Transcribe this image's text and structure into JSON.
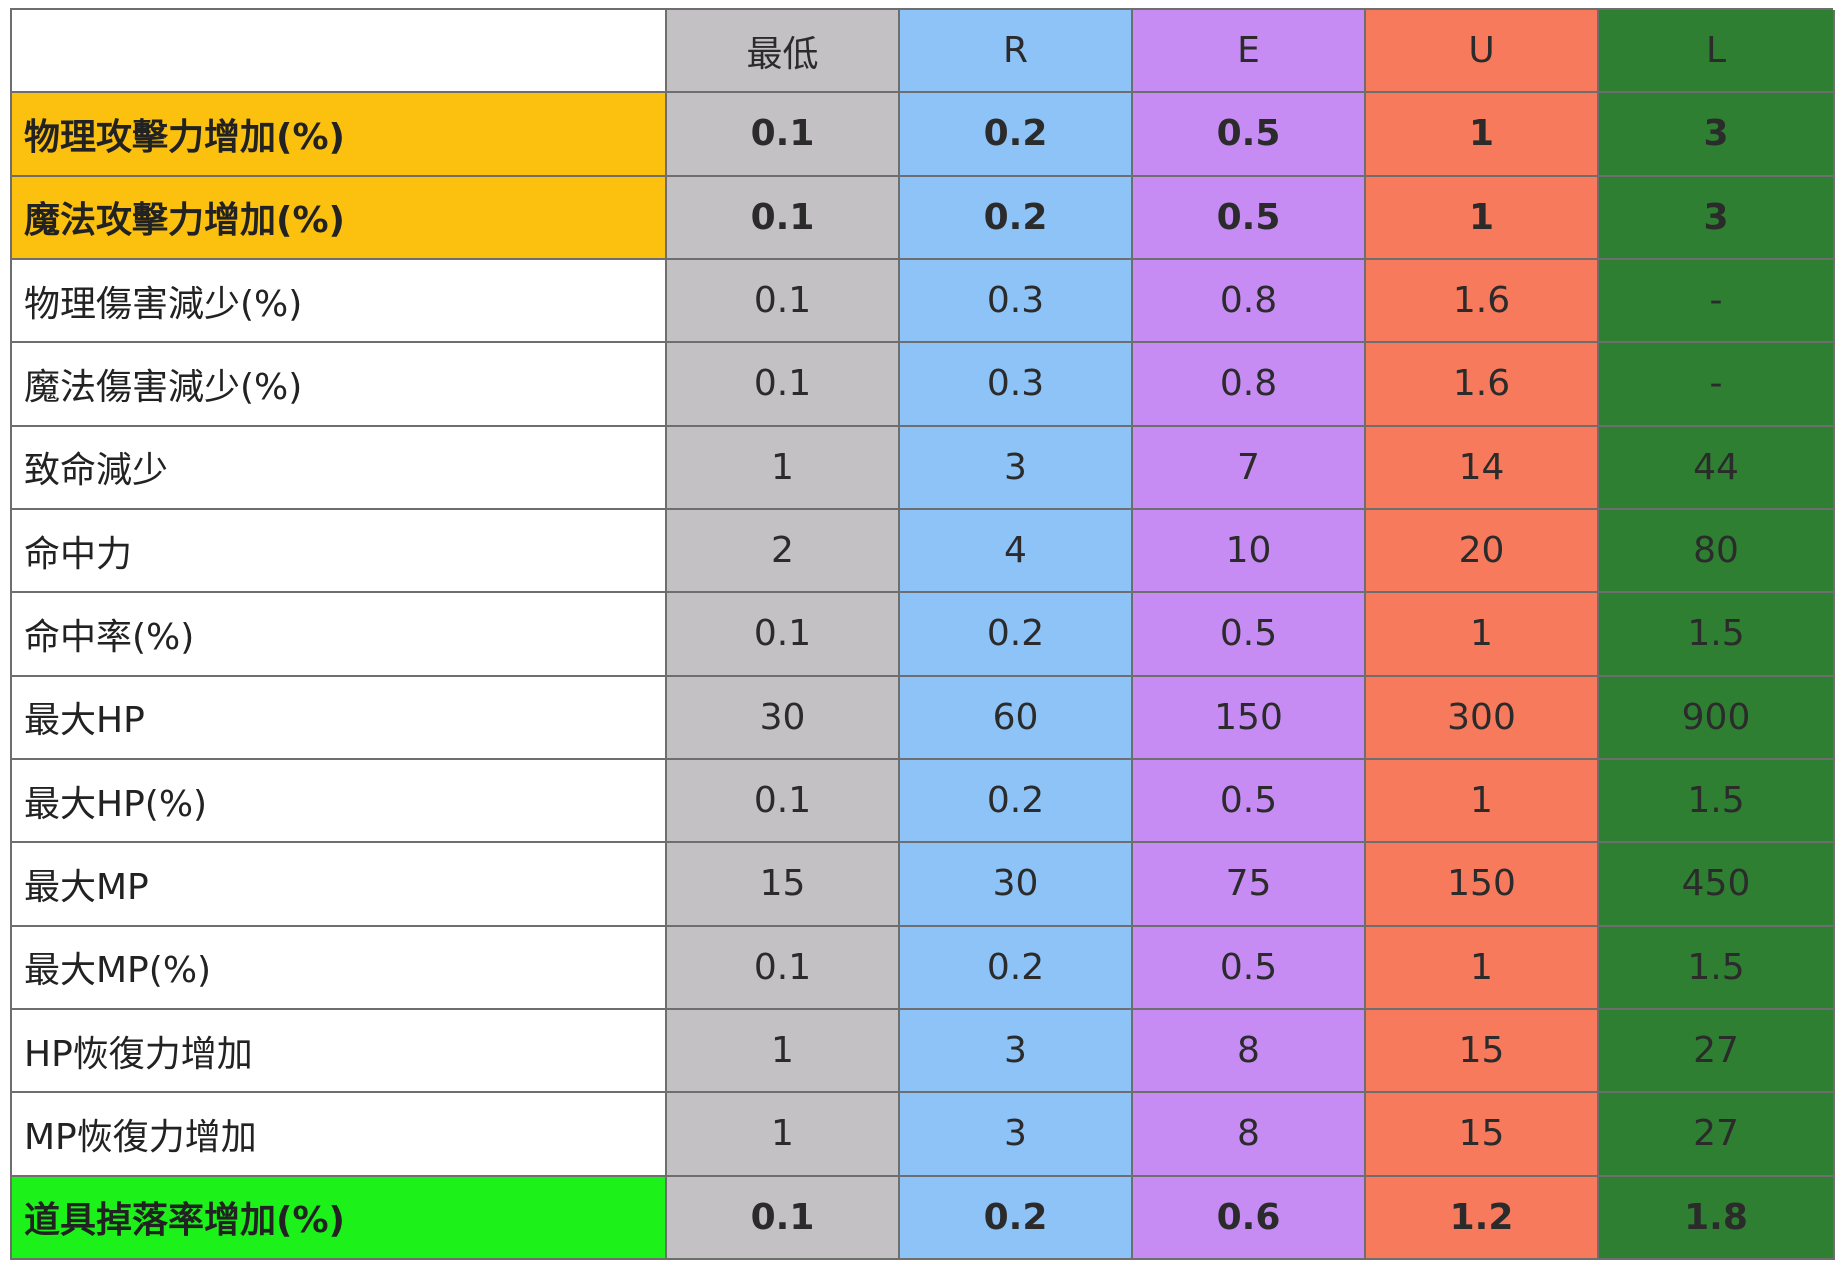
{
  "colors": {
    "col_lowest": "#c3c1c4",
    "col_r": "#8ec3f8",
    "col_e": "#c68cf4",
    "col_u": "#f77a5d",
    "col_l": "#2f7f33",
    "label_orange": "#fbc10e",
    "label_green": "#1cf21a",
    "grid": "#6e6e6e"
  },
  "table": {
    "columns": [
      "最低",
      "R",
      "E",
      "U",
      "L"
    ],
    "rows": [
      {
        "label": "物理攻擊力增加(%)",
        "values": [
          "0.1",
          "0.2",
          "0.5",
          "1",
          "3"
        ],
        "highlight": "orange",
        "bold": true
      },
      {
        "label": "魔法攻擊力增加(%)",
        "values": [
          "0.1",
          "0.2",
          "0.5",
          "1",
          "3"
        ],
        "highlight": "orange",
        "bold": true
      },
      {
        "label": "物理傷害減少(%)",
        "values": [
          "0.1",
          "0.3",
          "0.8",
          "1.6",
          "-"
        ]
      },
      {
        "label": "魔法傷害減少(%)",
        "values": [
          "0.1",
          "0.3",
          "0.8",
          "1.6",
          "-"
        ]
      },
      {
        "label": "致命減少",
        "values": [
          "1",
          "3",
          "7",
          "14",
          "44"
        ]
      },
      {
        "label": "命中力",
        "values": [
          "2",
          "4",
          "10",
          "20",
          "80"
        ]
      },
      {
        "label": "命中率(%)",
        "values": [
          "0.1",
          "0.2",
          "0.5",
          "1",
          "1.5"
        ]
      },
      {
        "label": "最大HP",
        "values": [
          "30",
          "60",
          "150",
          "300",
          "900"
        ]
      },
      {
        "label": "最大HP(%)",
        "values": [
          "0.1",
          "0.2",
          "0.5",
          "1",
          "1.5"
        ]
      },
      {
        "label": "最大MP",
        "values": [
          "15",
          "30",
          "75",
          "150",
          "450"
        ]
      },
      {
        "label": "最大MP(%)",
        "values": [
          "0.1",
          "0.2",
          "0.5",
          "1",
          "1.5"
        ]
      },
      {
        "label": "HP恢復力增加",
        "values": [
          "1",
          "3",
          "8",
          "15",
          "27"
        ]
      },
      {
        "label": "MP恢復力增加",
        "values": [
          "1",
          "3",
          "8",
          "15",
          "27"
        ]
      },
      {
        "label": "道具掉落率增加(%)",
        "values": [
          "0.1",
          "0.2",
          "0.6",
          "1.2",
          "1.8"
        ],
        "highlight": "green",
        "bold": true
      }
    ]
  }
}
